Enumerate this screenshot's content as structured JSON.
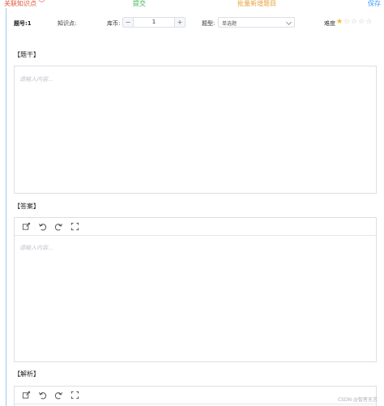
{
  "topbar": {
    "knowledge": "关联知识点",
    "submit": "提交",
    "batch": "批量新增题目",
    "save": "保存"
  },
  "meta": {
    "question_no": "题号:1",
    "knowledge_label": "知识点:",
    "library_label": "库币:",
    "library_minus": "−",
    "library_value": "1",
    "library_plus": "+",
    "type_label": "题型:",
    "type_value": "单选题",
    "difficulty_label": "难度",
    "difficulty_rating": 1,
    "difficulty_max": 5
  },
  "sections": {
    "stem": {
      "title": "【题干】",
      "placeholder": "请输入内容..."
    },
    "answer": {
      "title": "【答案】",
      "placeholder": "请输入内容..."
    },
    "analysis": {
      "title": "【解析】"
    }
  },
  "icons": {
    "toolbar": [
      "image-edit-icon",
      "undo-icon",
      "redo-icon",
      "fullscreen-icon"
    ]
  },
  "colors": {
    "knowledge": "#e0553c",
    "submit": "#3cb44a",
    "batch": "#e6a23c",
    "save": "#409eff",
    "star_on": "#f7ba2a",
    "star_off": "#c0c4cc"
  },
  "watermark": "CSDN @智者无言"
}
